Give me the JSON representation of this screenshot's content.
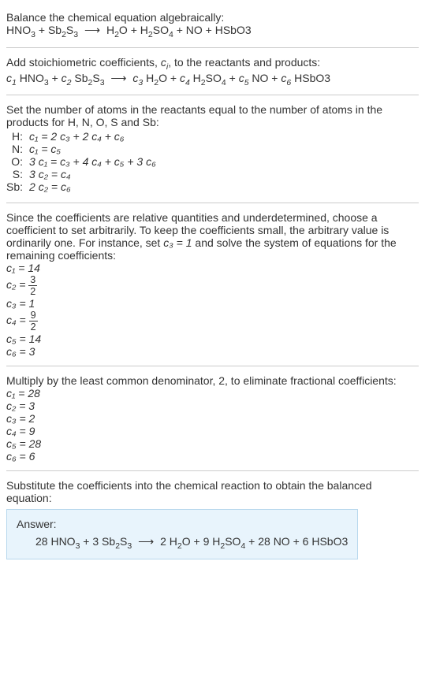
{
  "intro": {
    "line1": "Balance the chemical equation algebraically:",
    "eq_lhs_1": "HNO",
    "eq_lhs_1_sub": "3",
    "plus": " + ",
    "eq_lhs_2": "Sb",
    "eq_lhs_2_sub": "2",
    "eq_lhs_3": "S",
    "eq_lhs_3_sub": "3",
    "arrow": " ⟶ ",
    "eq_rhs_1": "H",
    "eq_rhs_1_sub": "2",
    "eq_rhs_2": "O + H",
    "eq_rhs_2_sub": "2",
    "eq_rhs_3": "SO",
    "eq_rhs_3_sub": "4",
    "eq_rhs_4": " + NO + HSbO3"
  },
  "step1": {
    "line1_a": "Add stoichiometric coefficients, ",
    "line1_c": "c",
    "line1_c_sub": "i",
    "line1_b": ", to the reactants and products:",
    "c1": "c",
    "c1_sub": "1",
    "sp1": " HNO",
    "sp1_sub": "3",
    "c2": "c",
    "c2_sub": "2",
    "sp2": " Sb",
    "sp2_sub": "2",
    "sp2b": "S",
    "sp2b_sub": "3",
    "c3": "c",
    "c3_sub": "3",
    "sp3": " H",
    "sp3_sub": "2",
    "sp3b": "O",
    "c4": "c",
    "c4_sub": "4",
    "sp4": " H",
    "sp4_sub": "2",
    "sp4b": "SO",
    "sp4b_sub": "4",
    "c5": "c",
    "c5_sub": "5",
    "sp5": " NO",
    "c6": "c",
    "c6_sub": "6",
    "sp6": " HSbO3"
  },
  "step2": {
    "intro": "Set the number of atoms in the reactants equal to the number of atoms in the products for H, N, O, S and Sb:",
    "rows": [
      {
        "el": "H:",
        "eq": "c₁ = 2 c₃ + 2 c₄ + c₆"
      },
      {
        "el": "N:",
        "eq": "c₁ = c₅"
      },
      {
        "el": "O:",
        "eq": "3 c₁ = c₃ + 4 c₄ + c₅ + 3 c₆"
      },
      {
        "el": "S:",
        "eq": "3 c₂ = c₄"
      },
      {
        "el": "Sb:",
        "eq": "2 c₂ = c₆"
      }
    ]
  },
  "step3": {
    "intro_a": "Since the coefficients are relative quantities and underdetermined, choose a coefficient to set arbitrarily. To keep the coefficients small, the arbitrary value is ordinarily one. For instance, set ",
    "intro_c3": "c₃ = 1",
    "intro_b": " and solve the system of equations for the remaining coefficients:",
    "c1": "c₁ = 14",
    "c2_lhs": "c₂ = ",
    "c2_num": "3",
    "c2_den": "2",
    "c3": "c₃ = 1",
    "c4_lhs": "c₄ = ",
    "c4_num": "9",
    "c4_den": "2",
    "c5": "c₅ = 14",
    "c6": "c₆ = 3"
  },
  "step4": {
    "intro": "Multiply by the least common denominator, 2, to eliminate fractional coefficients:",
    "lines": [
      "c₁ = 28",
      "c₂ = 3",
      "c₃ = 2",
      "c₄ = 9",
      "c₅ = 28",
      "c₆ = 6"
    ]
  },
  "step5": {
    "intro": "Substitute the coefficients into the chemical reaction to obtain the balanced equation:"
  },
  "answer": {
    "label": "Answer:",
    "c1": "28 HNO",
    "c1_sub": "3",
    "plus1": " + 3 Sb",
    "plus1_sub": "2",
    "plus1b": "S",
    "plus1b_sub": "3",
    "arrow": " ⟶ ",
    "r1": "2 H",
    "r1_sub": "2",
    "r1b": "O + 9 H",
    "r1b_sub": "2",
    "r1c": "SO",
    "r1c_sub": "4",
    "r2": " + 28 NO + 6 HSbO3"
  }
}
